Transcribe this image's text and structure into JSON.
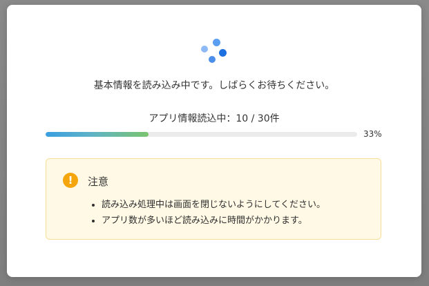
{
  "dialog": {
    "loading_message": "基本情報を読み込み中です。しばらくお待ちください。",
    "progress_label": "アプリ情報読込中：10 / 30件",
    "progress_percent_text": "33%",
    "progress_value": 0.33,
    "accent_color": "#3a9fe0"
  },
  "notice": {
    "icon": "exclamation-icon",
    "icon_glyph": "!",
    "title": "注意",
    "items": [
      "読み込み処理中は画面を閉じないようにしてください。",
      "アプリ数が多いほど読み込みに時間がかかります。"
    ],
    "background_color": "#fff9e5",
    "border_color": "#f5df98",
    "icon_color": "#f5a60c"
  },
  "spinner": {
    "icon": "loading-spinner-icon"
  }
}
